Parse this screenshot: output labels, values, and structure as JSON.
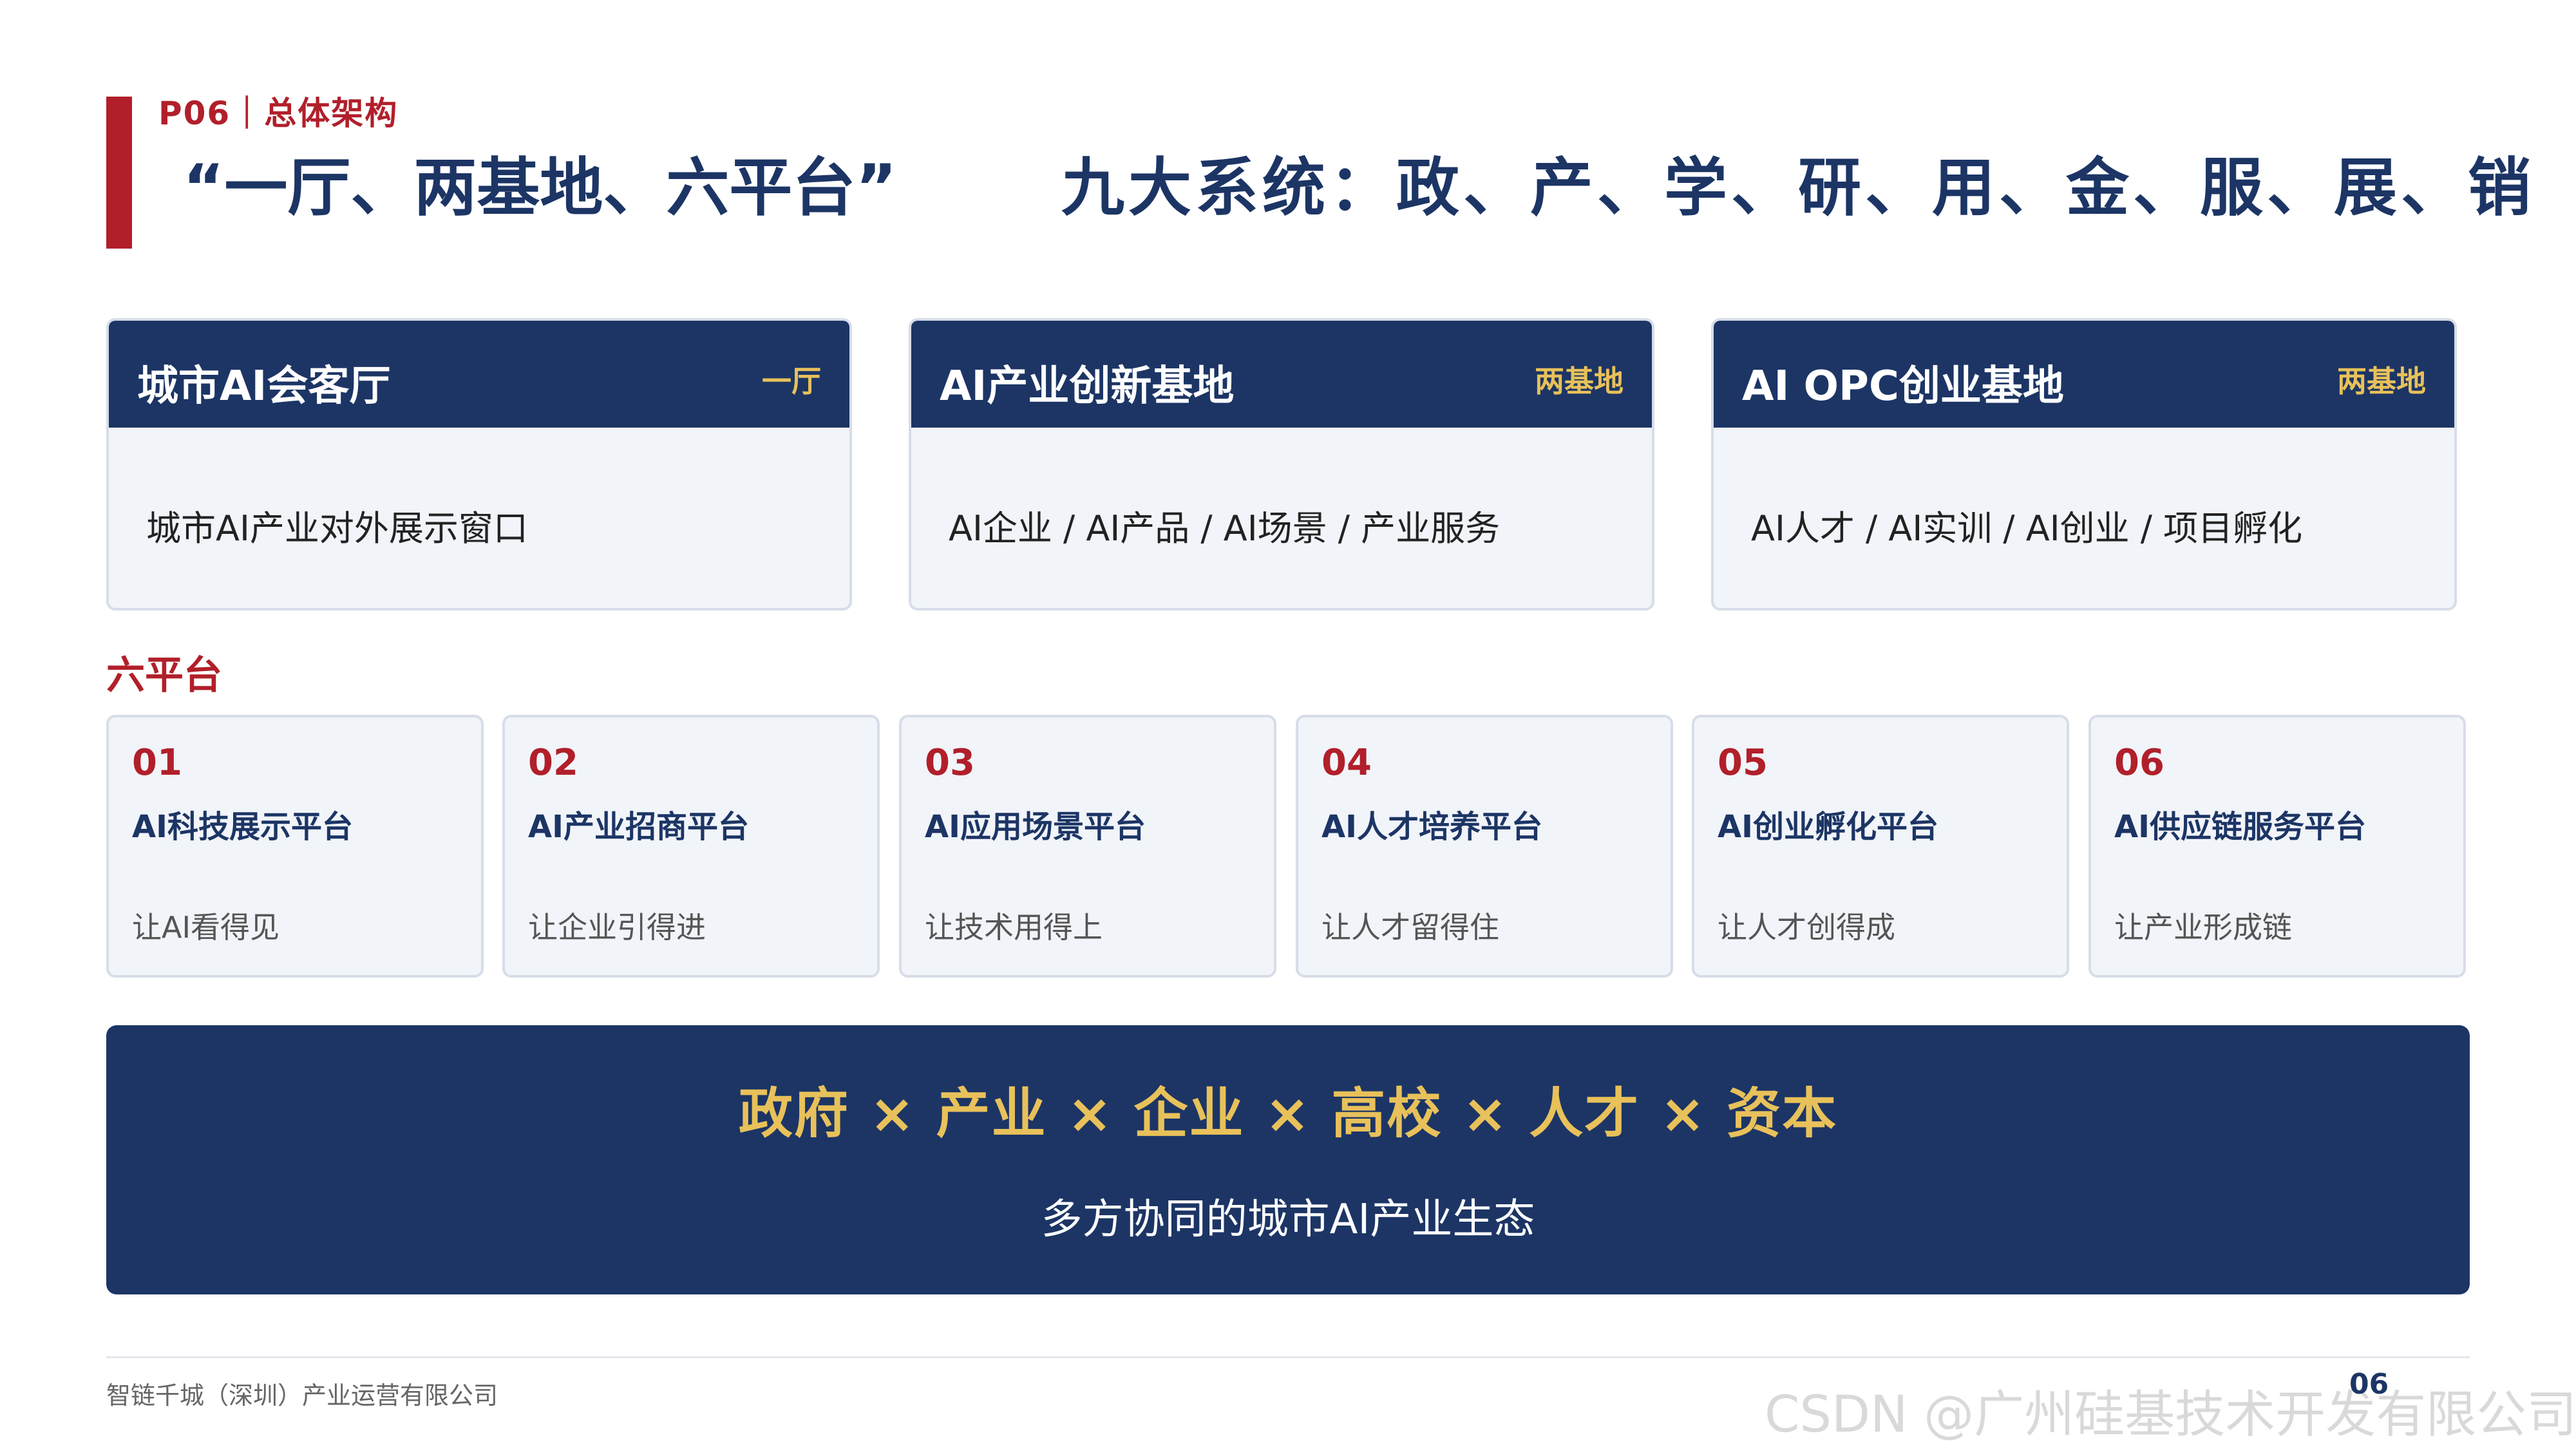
{
  "header": {
    "eyebrow": "P06｜总体架构",
    "title_left": "“一厅、两基地、六平台”",
    "title_right": "九大系统：政、产、学、研、用、金、服、展、销"
  },
  "bases": [
    {
      "title": "城市AI会客厅",
      "tag": "一厅",
      "desc": "城市AI产业对外展示窗口"
    },
    {
      "title": "AI产业创新基地",
      "tag": "两基地",
      "desc": "AI企业 / AI产品 / AI场景 / 产业服务"
    },
    {
      "title": "AI OPC创业基地",
      "tag": "两基地",
      "desc": "AI人才 / AI实训 / AI创业 / 项目孵化"
    }
  ],
  "platforms_section": {
    "label": "六平台",
    "items": [
      {
        "num": "01",
        "name": "AI科技展示平台",
        "desc": "让AI看得见"
      },
      {
        "num": "02",
        "name": "AI产业招商平台",
        "desc": "让企业引得进"
      },
      {
        "num": "03",
        "name": "AI应用场景平台",
        "desc": "让技术用得上"
      },
      {
        "num": "04",
        "name": "AI人才培养平台",
        "desc": "让人才留得住"
      },
      {
        "num": "05",
        "name": "AI创业孵化平台",
        "desc": "让人才创得成"
      },
      {
        "num": "06",
        "name": "AI供应链服务平台",
        "desc": "让产业形成链"
      }
    ]
  },
  "banner": {
    "main": "政府 × 产业 × 企业 × 高校 × 人才 × 资本",
    "sub": "多方协同的城市AI产业生态"
  },
  "footer": {
    "company": "智链千城（深圳）产业运营有限公司",
    "page": "06",
    "watermark": "CSDN @广州硅基技术开发有限公司"
  },
  "colors": {
    "navy": "#1c3565",
    "red": "#b11f2a",
    "gold": "#e8c15a",
    "card_bg": "#f1f4f9"
  }
}
